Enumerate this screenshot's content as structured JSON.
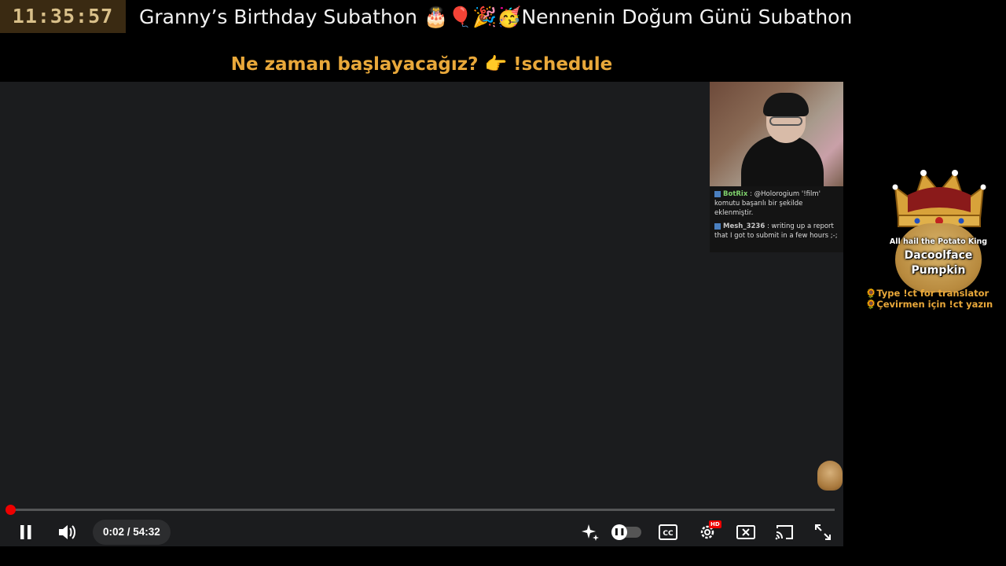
{
  "overlay": {
    "clock": "11:35:57",
    "title": "Granny’s Birthday Subathon 🎂🎈🎉🥳Nennenin Doğum Günü Subathon",
    "announcement": "Ne zaman başlayacağız? 👉 !schedule"
  },
  "webcam_chat": [
    {
      "user": "BotRix",
      "text": "@Holorogium '!film' komutu başarılı bir şekilde eklenmiştir."
    },
    {
      "user": "Mesh_3236",
      "text": "writing up a report that I got to submit in a few hours ;-;"
    }
  ],
  "player": {
    "time_display": "0:02 / 54:32",
    "progress_fraction": 0.0006,
    "play_state": "playing",
    "hd_badge": "HD",
    "colors": {
      "progress": "#ee0000",
      "background": "#1b1c1e"
    },
    "icons": [
      "pause-icon",
      "volume-icon",
      "sparkle-icon",
      "autoplay-toggle",
      "captions-icon",
      "settings-icon",
      "theater-icon",
      "cast-icon",
      "fullscreen-icon"
    ]
  },
  "side_panel": {
    "potato_caption": "All hail the Potato King",
    "potato_name_line1": "Dacoolface",
    "potato_name_line2": "Pumpkin",
    "translator_en": "🌻Type !ct for translator",
    "translator_tr": "🌻Çevirmen için !ct yazın"
  }
}
